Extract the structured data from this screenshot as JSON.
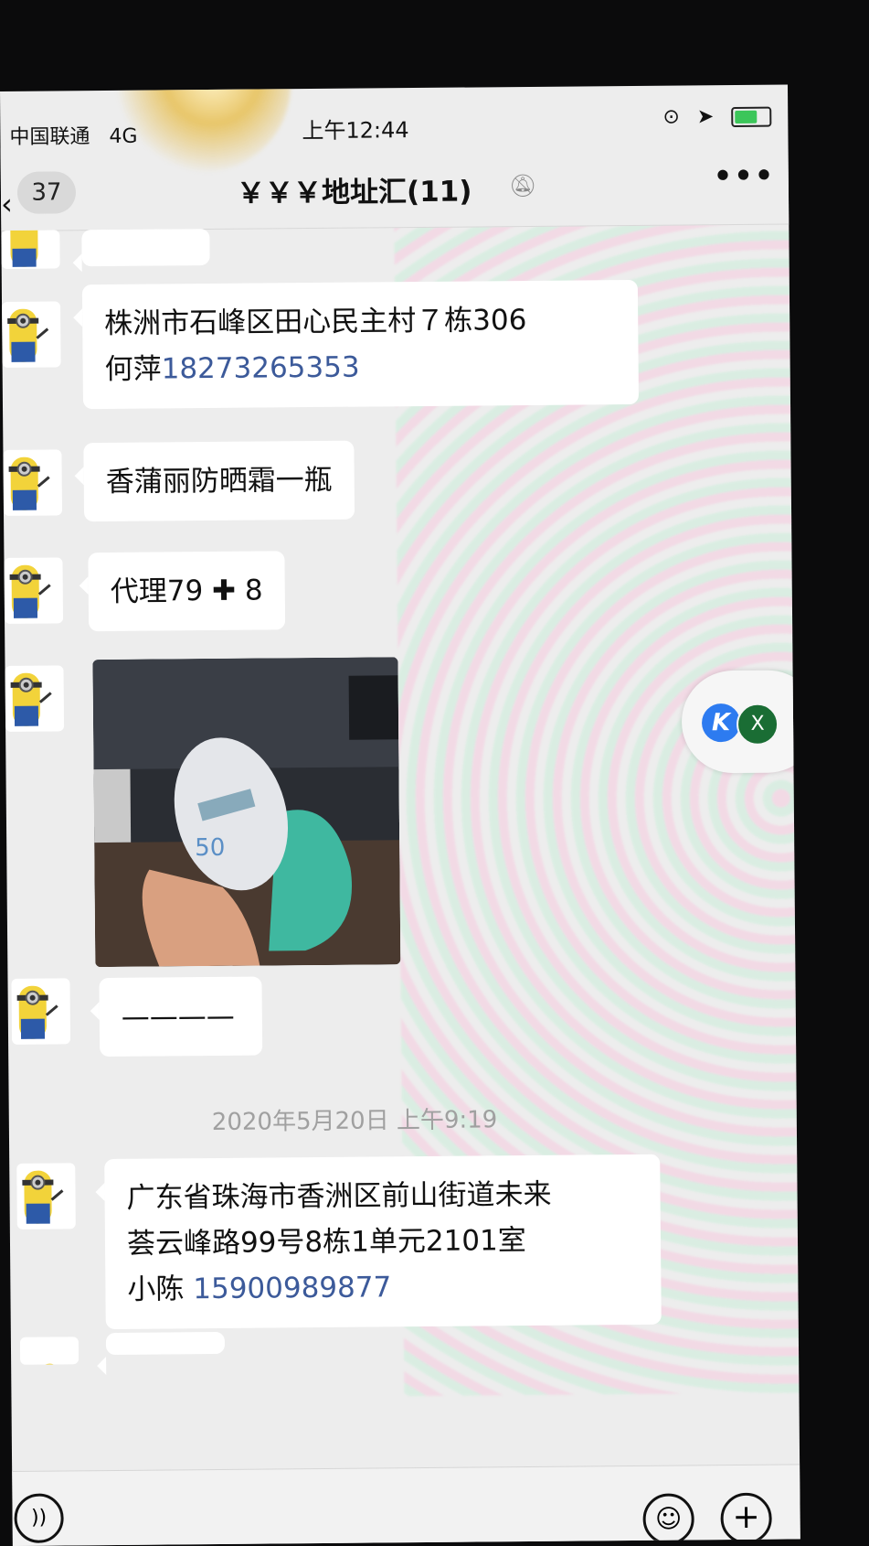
{
  "status_bar": {
    "carrier": "中国联通",
    "network": "4G",
    "time": "上午12:44",
    "icons": [
      "rotation-lock-icon",
      "location-arrow-icon",
      "battery-charging-icon"
    ]
  },
  "header": {
    "back_badge": "37",
    "title": "￥￥￥地址汇(11)",
    "mute_icon": "bell-slash-icon",
    "more_label": "•••"
  },
  "messages": [
    {
      "line1": "株洲市石峰区田心民主村７栋306",
      "line2_name": "何萍",
      "line2_phone": "18273265353"
    },
    {
      "text": "香蒲丽防晒霜一瓶"
    },
    {
      "text": "代理79 ✚ 8"
    },
    {
      "type": "image",
      "alt": "sunscreen photo"
    },
    {
      "text": "————"
    },
    {
      "line1": "广东省珠海市香洲区前山街道未来",
      "line2": "荟云峰路99号8栋1单元2101室",
      "line3_name": "小陈 ",
      "line3_phone": "15900989877"
    }
  ],
  "timestamp": "2020年5月20日 上午9:19",
  "floating": {
    "icon_a": "K",
    "icon_b": "X"
  },
  "input_bar": {
    "voice_icon": "voice-icon",
    "emoji_icon": "emoji-icon",
    "plus_icon": "plus-icon"
  },
  "colors": {
    "background": "#ededed",
    "bubble": "#ffffff",
    "link": "#3c5a9a",
    "battery": "#3cc65a"
  }
}
